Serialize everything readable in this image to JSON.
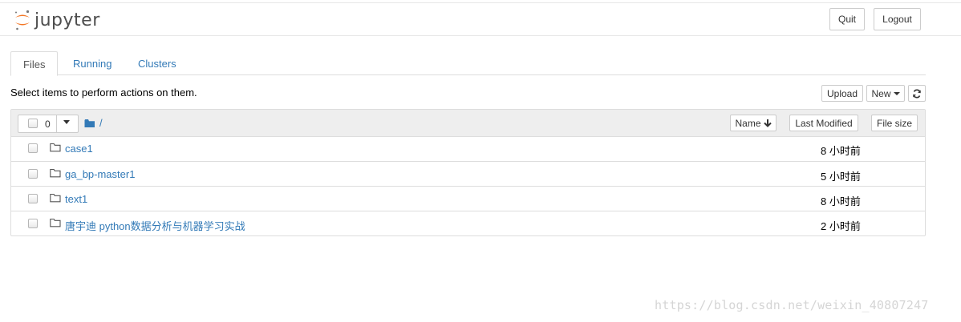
{
  "header": {
    "logo_text": "jupyter",
    "quit_label": "Quit",
    "logout_label": "Logout"
  },
  "tabs": [
    {
      "label": "Files",
      "active": true
    },
    {
      "label": "Running",
      "active": false
    },
    {
      "label": "Clusters",
      "active": false
    }
  ],
  "toolbar": {
    "hint": "Select items to perform actions on them.",
    "upload_label": "Upload",
    "new_label": "New"
  },
  "list_header": {
    "selected_count": "0",
    "path": "/",
    "sort_name_label": "Name",
    "sort_modified_label": "Last Modified",
    "sort_size_label": "File size"
  },
  "items": [
    {
      "name": "case1",
      "modified": "8 小时前"
    },
    {
      "name": "ga_bp-master1",
      "modified": "5 小时前"
    },
    {
      "name": "text1",
      "modified": "8 小时前"
    },
    {
      "name": "唐宇迪 python数据分析与机器学习实战",
      "modified": "2 小时前"
    }
  ],
  "watermark": "https://blog.csdn.net/weixin_40807247",
  "colors": {
    "link": "#337ab7",
    "jupyter_orange": "#f37726",
    "logo_gray": "#4e4e4e",
    "header_bg": "#eeeeee",
    "border": "#dddddd"
  }
}
